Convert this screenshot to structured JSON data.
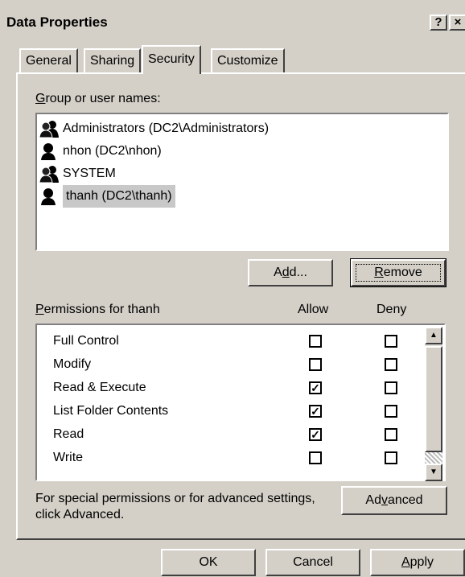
{
  "window": {
    "title": "Data Properties",
    "help_label": "?",
    "close_label": "×"
  },
  "tabs": [
    {
      "label": "General",
      "active": false
    },
    {
      "label": "Sharing",
      "active": false
    },
    {
      "label": "Security",
      "active": true
    },
    {
      "label": "Customize",
      "active": false
    }
  ],
  "security": {
    "group_label_underline": "G",
    "group_label_rest": "roup or user names:",
    "users": [
      {
        "name": "Administrators (DC2\\Administrators)",
        "icon": "group-user-icon",
        "selected": false
      },
      {
        "name": "nhon (DC2\\nhon)",
        "icon": "user-icon",
        "selected": false
      },
      {
        "name": "SYSTEM",
        "icon": "group-user-icon",
        "selected": false
      },
      {
        "name": "thanh (DC2\\thanh)",
        "icon": "user-icon",
        "selected": true
      }
    ],
    "add_button_pre": "A",
    "add_button_underline": "d",
    "add_button_post": "d...",
    "remove_button_underline": "R",
    "remove_button_rest": "emove",
    "perm_label_underline": "P",
    "perm_label_rest": "ermissions for thanh",
    "allow_header": "Allow",
    "deny_header": "Deny",
    "permissions": [
      {
        "name": "Full Control",
        "allow": false,
        "deny": false
      },
      {
        "name": "Modify",
        "allow": false,
        "deny": false
      },
      {
        "name": "Read & Execute",
        "allow": true,
        "deny": false
      },
      {
        "name": "List Folder Contents",
        "allow": true,
        "deny": false
      },
      {
        "name": "Read",
        "allow": true,
        "deny": false
      },
      {
        "name": "Write",
        "allow": false,
        "deny": false
      }
    ],
    "special_text_line1": "For special permissions or for advanced settings,",
    "special_text_line2": "click Advanced.",
    "advanced_pre": "Ad",
    "advanced_underline": "v",
    "advanced_post": "anced"
  },
  "footer": {
    "ok_label": "OK",
    "cancel_label": "Cancel",
    "apply_underline": "A",
    "apply_rest": "pply"
  }
}
